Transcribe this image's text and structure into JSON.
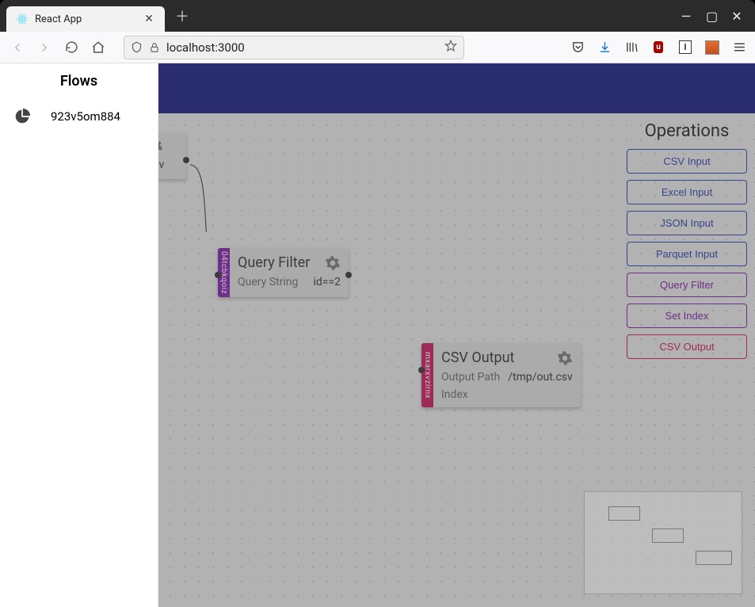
{
  "browser": {
    "tab_title": "React App",
    "url": "localhost:3000"
  },
  "sidebar": {
    "title": "Flows",
    "items": [
      {
        "label": "923v5om884"
      }
    ]
  },
  "operations": {
    "title": "Operations",
    "buttons": [
      {
        "label": "CSV Input",
        "style": "blue"
      },
      {
        "label": "Excel Input",
        "style": "blue"
      },
      {
        "label": "JSON Input",
        "style": "blue"
      },
      {
        "label": "Parquet Input",
        "style": "blue"
      },
      {
        "label": "Query Filter",
        "style": "purple"
      },
      {
        "label": "Set Index",
        "style": "purple"
      },
      {
        "label": "CSV Output",
        "style": "pink"
      }
    ]
  },
  "nodes": {
    "csv_input": {
      "tag": "",
      "file_ext": "csv"
    },
    "query_filter": {
      "tag": "04tcbkqoiz",
      "title": "Query Filter",
      "params": [
        {
          "key": "Query String",
          "value": "id==2"
        }
      ]
    },
    "csv_output": {
      "tag": "mxarxvzirnx",
      "title": "CSV Output",
      "params": [
        {
          "key": "Output Path",
          "value": "/tmp/out.csv"
        },
        {
          "key": "Index",
          "value": ""
        }
      ]
    }
  }
}
